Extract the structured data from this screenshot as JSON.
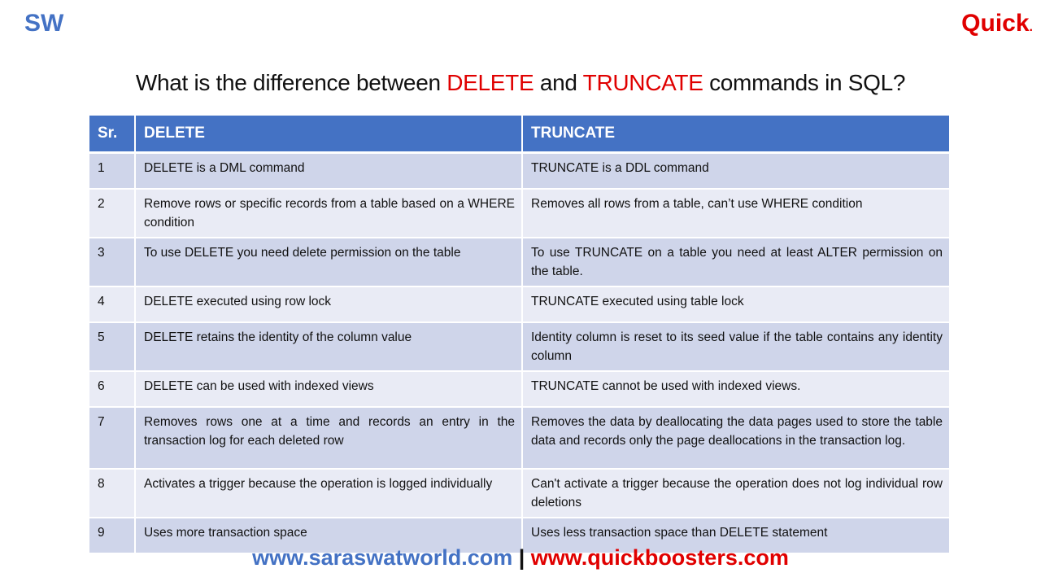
{
  "branding": {
    "left_logo": "SW",
    "right_logo": "Quick",
    "right_logo_dot": "."
  },
  "title": {
    "prefix": "What is the difference between ",
    "term1": "DELETE",
    "middle": " and ",
    "term2": "TRUNCATE",
    "suffix": " commands in SQL?"
  },
  "table": {
    "headers": [
      "Sr.",
      "DELETE",
      "TRUNCATE"
    ],
    "rows": [
      {
        "sr": "1",
        "delete": "DELETE is a DML command",
        "truncate": "TRUNCATE is a DDL command"
      },
      {
        "sr": "2",
        "delete": "Remove rows or specific records from a table based on a WHERE condition",
        "truncate": "Removes all rows from a table, can’t use WHERE condition"
      },
      {
        "sr": "3",
        "delete": "To use DELETE you need delete permission on the table",
        "truncate": "To use TRUNCATE on a table you need at least ALTER permission on the table."
      },
      {
        "sr": "4",
        "delete": "DELETE executed using row lock",
        "truncate": "TRUNCATE executed using table lock"
      },
      {
        "sr": "5",
        "delete": "DELETE retains the identity of the column value",
        "truncate": "Identity column is reset to its seed value if the table contains any identity column"
      },
      {
        "sr": "6",
        "delete": "DELETE can be used with indexed views",
        "truncate": "TRUNCATE cannot be used with indexed views."
      },
      {
        "sr": "7",
        "delete": "Removes rows one at a time and records an entry in the transaction log for each deleted row",
        "truncate": "Removes the data by deallocating the data pages used to store the table data and records only the page deallocations in the transaction log."
      },
      {
        "sr": "8",
        "delete": "Activates a trigger because the operation is logged individually",
        "truncate": "Can't activate a trigger because the operation does not log individual row deletions"
      },
      {
        "sr": "9",
        "delete": "Uses more transaction space",
        "truncate": "Uses less transaction space than DELETE statement"
      }
    ]
  },
  "footer": {
    "link1": "www.saraswatworld.com",
    "separator": " | ",
    "link2": "www.quickboosters.com"
  },
  "colors": {
    "brand_blue": "#4472c4",
    "brand_red": "#e00000",
    "row_dark": "#cfd5ea",
    "row_light": "#e9ebf5"
  }
}
